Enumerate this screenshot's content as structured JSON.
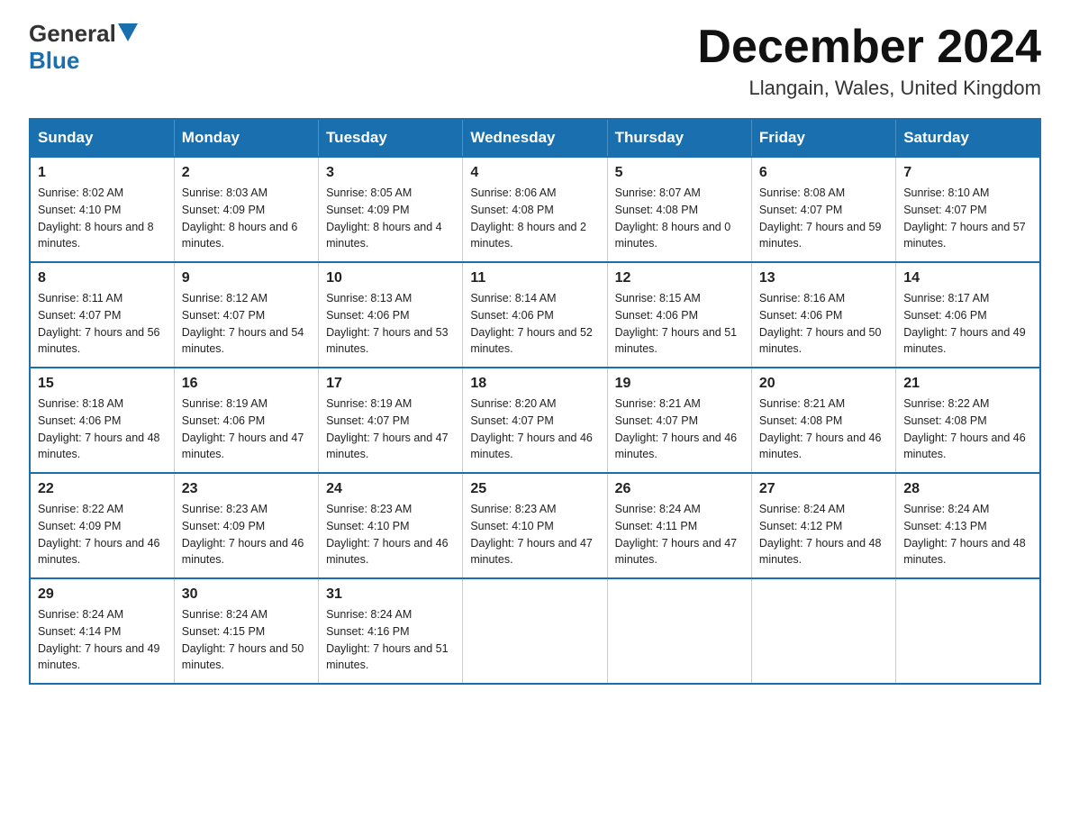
{
  "logo": {
    "general": "General",
    "blue": "Blue"
  },
  "title": "December 2024",
  "location": "Llangain, Wales, United Kingdom",
  "days_of_week": [
    "Sunday",
    "Monday",
    "Tuesday",
    "Wednesday",
    "Thursday",
    "Friday",
    "Saturday"
  ],
  "weeks": [
    [
      {
        "day": "1",
        "sunrise": "8:02 AM",
        "sunset": "4:10 PM",
        "daylight": "8 hours and 8 minutes."
      },
      {
        "day": "2",
        "sunrise": "8:03 AM",
        "sunset": "4:09 PM",
        "daylight": "8 hours and 6 minutes."
      },
      {
        "day": "3",
        "sunrise": "8:05 AM",
        "sunset": "4:09 PM",
        "daylight": "8 hours and 4 minutes."
      },
      {
        "day": "4",
        "sunrise": "8:06 AM",
        "sunset": "4:08 PM",
        "daylight": "8 hours and 2 minutes."
      },
      {
        "day": "5",
        "sunrise": "8:07 AM",
        "sunset": "4:08 PM",
        "daylight": "8 hours and 0 minutes."
      },
      {
        "day": "6",
        "sunrise": "8:08 AM",
        "sunset": "4:07 PM",
        "daylight": "7 hours and 59 minutes."
      },
      {
        "day": "7",
        "sunrise": "8:10 AM",
        "sunset": "4:07 PM",
        "daylight": "7 hours and 57 minutes."
      }
    ],
    [
      {
        "day": "8",
        "sunrise": "8:11 AM",
        "sunset": "4:07 PM",
        "daylight": "7 hours and 56 minutes."
      },
      {
        "day": "9",
        "sunrise": "8:12 AM",
        "sunset": "4:07 PM",
        "daylight": "7 hours and 54 minutes."
      },
      {
        "day": "10",
        "sunrise": "8:13 AM",
        "sunset": "4:06 PM",
        "daylight": "7 hours and 53 minutes."
      },
      {
        "day": "11",
        "sunrise": "8:14 AM",
        "sunset": "4:06 PM",
        "daylight": "7 hours and 52 minutes."
      },
      {
        "day": "12",
        "sunrise": "8:15 AM",
        "sunset": "4:06 PM",
        "daylight": "7 hours and 51 minutes."
      },
      {
        "day": "13",
        "sunrise": "8:16 AM",
        "sunset": "4:06 PM",
        "daylight": "7 hours and 50 minutes."
      },
      {
        "day": "14",
        "sunrise": "8:17 AM",
        "sunset": "4:06 PM",
        "daylight": "7 hours and 49 minutes."
      }
    ],
    [
      {
        "day": "15",
        "sunrise": "8:18 AM",
        "sunset": "4:06 PM",
        "daylight": "7 hours and 48 minutes."
      },
      {
        "day": "16",
        "sunrise": "8:19 AM",
        "sunset": "4:06 PM",
        "daylight": "7 hours and 47 minutes."
      },
      {
        "day": "17",
        "sunrise": "8:19 AM",
        "sunset": "4:07 PM",
        "daylight": "7 hours and 47 minutes."
      },
      {
        "day": "18",
        "sunrise": "8:20 AM",
        "sunset": "4:07 PM",
        "daylight": "7 hours and 46 minutes."
      },
      {
        "day": "19",
        "sunrise": "8:21 AM",
        "sunset": "4:07 PM",
        "daylight": "7 hours and 46 minutes."
      },
      {
        "day": "20",
        "sunrise": "8:21 AM",
        "sunset": "4:08 PM",
        "daylight": "7 hours and 46 minutes."
      },
      {
        "day": "21",
        "sunrise": "8:22 AM",
        "sunset": "4:08 PM",
        "daylight": "7 hours and 46 minutes."
      }
    ],
    [
      {
        "day": "22",
        "sunrise": "8:22 AM",
        "sunset": "4:09 PM",
        "daylight": "7 hours and 46 minutes."
      },
      {
        "day": "23",
        "sunrise": "8:23 AM",
        "sunset": "4:09 PM",
        "daylight": "7 hours and 46 minutes."
      },
      {
        "day": "24",
        "sunrise": "8:23 AM",
        "sunset": "4:10 PM",
        "daylight": "7 hours and 46 minutes."
      },
      {
        "day": "25",
        "sunrise": "8:23 AM",
        "sunset": "4:10 PM",
        "daylight": "7 hours and 47 minutes."
      },
      {
        "day": "26",
        "sunrise": "8:24 AM",
        "sunset": "4:11 PM",
        "daylight": "7 hours and 47 minutes."
      },
      {
        "day": "27",
        "sunrise": "8:24 AM",
        "sunset": "4:12 PM",
        "daylight": "7 hours and 48 minutes."
      },
      {
        "day": "28",
        "sunrise": "8:24 AM",
        "sunset": "4:13 PM",
        "daylight": "7 hours and 48 minutes."
      }
    ],
    [
      {
        "day": "29",
        "sunrise": "8:24 AM",
        "sunset": "4:14 PM",
        "daylight": "7 hours and 49 minutes."
      },
      {
        "day": "30",
        "sunrise": "8:24 AM",
        "sunset": "4:15 PM",
        "daylight": "7 hours and 50 minutes."
      },
      {
        "day": "31",
        "sunrise": "8:24 AM",
        "sunset": "4:16 PM",
        "daylight": "7 hours and 51 minutes."
      },
      null,
      null,
      null,
      null
    ]
  ],
  "labels": {
    "sunrise": "Sunrise:",
    "sunset": "Sunset:",
    "daylight": "Daylight:"
  }
}
